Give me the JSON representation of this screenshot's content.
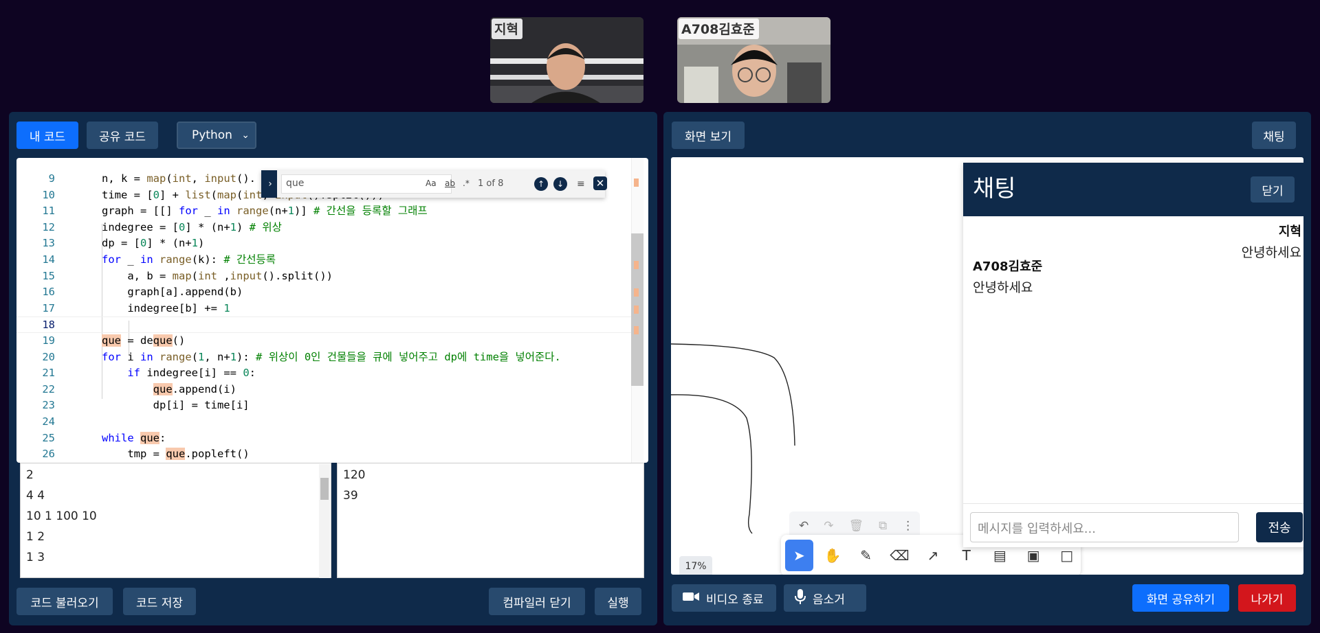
{
  "participants": [
    {
      "name": "지혁"
    },
    {
      "name": "A708김효준"
    }
  ],
  "code_panel": {
    "my_code_label": "내 코드",
    "shared_code_label": "공유 코드",
    "language": "Python",
    "load_code_label": "코드 불러오기",
    "save_code_label": "코드 저장",
    "close_compiler_label": "컴파일러 닫기",
    "run_label": "실행"
  },
  "find": {
    "query": "que",
    "match_case": "Aa",
    "whole_word": "ab",
    "regex": ".*",
    "count": "1 of 8"
  },
  "code_lines": [
    {
      "ln": "9"
    },
    {
      "ln": "10"
    },
    {
      "ln": "11"
    },
    {
      "ln": "12"
    },
    {
      "ln": "13"
    },
    {
      "ln": "14"
    },
    {
      "ln": "15"
    },
    {
      "ln": "16"
    },
    {
      "ln": "17"
    },
    {
      "ln": "18"
    },
    {
      "ln": "19"
    },
    {
      "ln": "20"
    },
    {
      "ln": "21"
    },
    {
      "ln": "22"
    },
    {
      "ln": "23"
    },
    {
      "ln": "24"
    },
    {
      "ln": "25"
    },
    {
      "ln": "26"
    }
  ],
  "stdin": [
    "2",
    "4 4",
    "10 1 100 10",
    "1 2",
    "1 3"
  ],
  "stdout": [
    "120",
    "39"
  ],
  "view_panel": {
    "screen_view_label": "화면 보기",
    "chat_toggle_label": "채팅",
    "zoom": "17%",
    "video_stop_label": "비디오 종료",
    "mute_label": "음소거",
    "share_screen_label": "화면 공유하기",
    "leave_label": "나가기"
  },
  "chat": {
    "title": "채팅",
    "close_label": "닫기",
    "messages": [
      {
        "author": "지혁",
        "text": "안녕하세요"
      },
      {
        "author": "A708김효준",
        "text": "안녕하세요"
      }
    ],
    "placeholder": "메시지를 입력하세요...",
    "send_label": "전송"
  }
}
